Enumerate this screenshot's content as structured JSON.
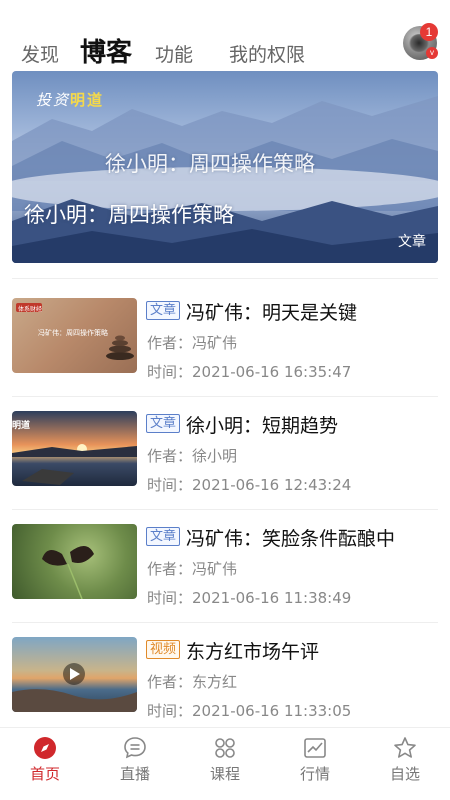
{
  "top_tabs": [
    {
      "label": "发现",
      "active": false
    },
    {
      "label": "博客",
      "active": true
    },
    {
      "label": "功能",
      "active": false
    },
    {
      "label": "我的权限",
      "active": false
    }
  ],
  "avatar": {
    "badge_count": "1",
    "vip_mark": "v"
  },
  "banner": {
    "logo_text_a": "投资",
    "logo_text_b": "明道",
    "overlay_title_faded": "徐小明：周四操作策略",
    "title": "徐小明：周四操作策略",
    "tag": "文章"
  },
  "feed": [
    {
      "tag": "文章",
      "tag_type": "article",
      "title": "冯矿伟：明天是关键",
      "author_label": "作者：",
      "author": "冯矿伟",
      "time_label": "时间：",
      "time": "2021-06-16 16:35:47",
      "thumb_caption": "冯矿伟：周四操作策略",
      "thumb_logo": "体系财经"
    },
    {
      "tag": "文章",
      "tag_type": "article",
      "title": "徐小明：短期趋势",
      "author_label": "作者：",
      "author": "徐小明",
      "time_label": "时间：",
      "time": "2021-06-16 12:43:24",
      "thumb_logo": "明道"
    },
    {
      "tag": "文章",
      "tag_type": "article",
      "title": "冯矿伟：笑脸条件酝酿中",
      "author_label": "作者：",
      "author": "冯矿伟",
      "time_label": "时间：",
      "time": "2021-06-16 11:38:49"
    },
    {
      "tag": "视频",
      "tag_type": "video",
      "title": "东方红市场午评",
      "author_label": "作者：",
      "author": "东方红",
      "time_label": "时间：",
      "time": "2021-06-16 11:33:05"
    }
  ],
  "bottom_nav": [
    {
      "label": "首页",
      "icon": "compass-icon",
      "active": true
    },
    {
      "label": "直播",
      "icon": "chat-bubble-icon",
      "active": false
    },
    {
      "label": "课程",
      "icon": "grid-flower-icon",
      "active": false
    },
    {
      "label": "行情",
      "icon": "line-chart-icon",
      "active": false
    },
    {
      "label": "自选",
      "icon": "star-icon",
      "active": false
    }
  ],
  "colors": {
    "accent": "#d0282c",
    "tag_article": "#5b7fc9",
    "tag_video": "#e08a2a",
    "badge": "#e53935"
  }
}
